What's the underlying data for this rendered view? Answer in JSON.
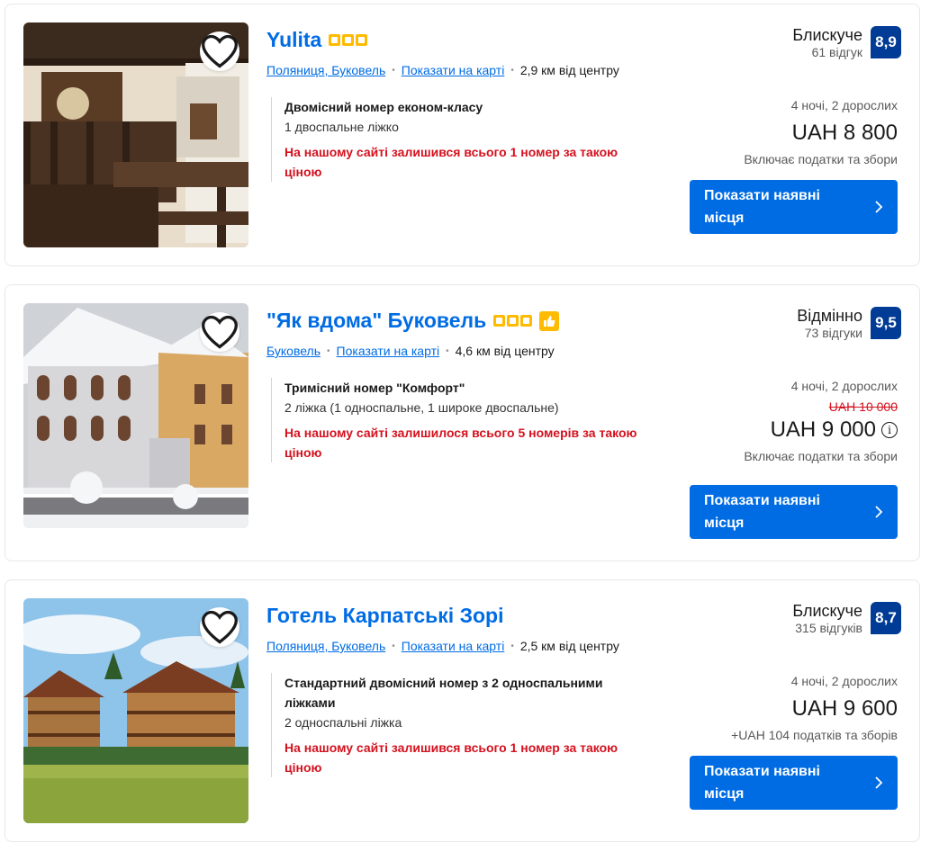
{
  "listings": [
    {
      "title": "Yulita",
      "stars": 3,
      "location_links": [
        "Поляниця, Буковель",
        "Показати на карті"
      ],
      "distance": "2,9 км від центру",
      "room_name": "Двомісний номер економ-класу",
      "room_beds": "1 двоспальне ліжко",
      "room_warning": "На нашому сайті залишився всього 1 номер за такою ціною",
      "review_word": "Блискуче",
      "review_count": "61 відгук",
      "score": "8,9",
      "nights": "4 ночі, 2 дорослих",
      "price": "UAH 8 800",
      "taxes": "Включає податки та збори",
      "button": "Показати наявні місця",
      "photo_icon": "cabin-interior-photo"
    },
    {
      "title": "\"Як вдома\" Буковель",
      "stars": 3,
      "location_links": [
        "Буковель",
        "Показати на карті"
      ],
      "distance": "4,6 км від центру",
      "room_name": "Тримісний номер \"Комфорт\"",
      "room_beds": "2 ліжка (1 односпальне, 1 широке двоспальне)",
      "room_warning": "На нашому сайті залишилося всього 5 номерів за такою ціною",
      "review_word": "Відмінно",
      "review_count": "73 відгуки",
      "score": "9,5",
      "nights": "4 ночі, 2 дорослих",
      "old_price": "UAH 10 000",
      "price": "UAH 9 000",
      "taxes": "Включає податки та збори",
      "button": "Показати наявні місця",
      "photo_icon": "snowy-hotel-photo"
    },
    {
      "title": "Готель Карпатські Зорі",
      "location_links": [
        "Поляниця, Буковель",
        "Показати на карті"
      ],
      "distance": "2,5 км від центру",
      "room_name": "Стандартний двомісний номер з 2 односпальними ліжками",
      "room_beds": "2 односпальні ліжка",
      "room_warning": "На нашому сайті залишився всього 1 номер за такою ціною",
      "review_word": "Блискуче",
      "review_count": "315 відгуків",
      "score": "8,7",
      "nights": "4 ночі, 2 дорослих",
      "price": "UAH 9 600",
      "taxes": "+UAH 104 податків та зборів",
      "button": "Показати наявні місця",
      "photo_icon": "mountain-chalet-photo"
    }
  ],
  "colors": {
    "link": "#006ce4",
    "score_bg": "#003b95",
    "warning": "#d4111e",
    "star": "#febb02",
    "button": "#006ce4"
  }
}
